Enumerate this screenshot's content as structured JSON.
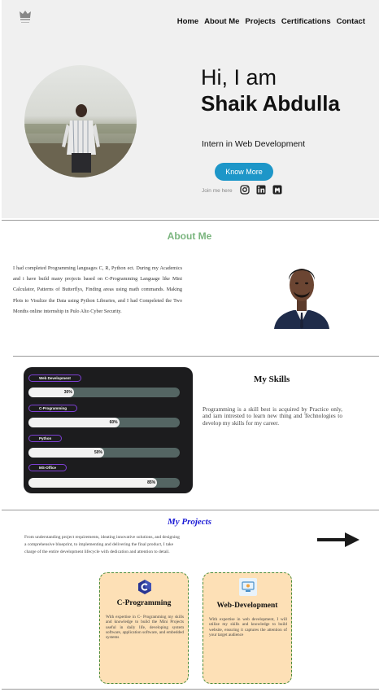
{
  "nav": {
    "items": [
      {
        "label": "Home"
      },
      {
        "label": "About Me"
      },
      {
        "label": "Projects"
      },
      {
        "label": "Certifications"
      },
      {
        "label": "Contact"
      }
    ]
  },
  "hero": {
    "greeting": "Hi, I am",
    "name": "Shaik Abdulla",
    "role": "Intern in Web Development",
    "cta_label": "Know More",
    "join_text": "Join me here",
    "social_icons": [
      "instagram-icon",
      "linkedin-icon",
      "github-icon"
    ]
  },
  "about": {
    "title": "About Me",
    "text": "I had completed Programming languages C, R, Python ect. During my Academics and i have build many projects based on C-Programming Language like Mini Calculator, Patterns of Butterflys, Finding areas using math commands. Making Plots to Visulize the Data using Python Libraries, and I had Compeleted the Two Months online internship in Pulo Alto Cyber Security."
  },
  "skills": {
    "title": "My Skills",
    "text": "Programming is a skill best is acquired by Practice only, and iam intrested to learn new thing and Technologies to develop my skills for my career.",
    "items": [
      {
        "label": "Web Development",
        "pct_label": "30%",
        "value": 0.3
      },
      {
        "label": "C-Programming",
        "pct_label": "60%",
        "value": 0.6
      },
      {
        "label": "Python",
        "pct_label": "50%",
        "value": 0.5
      },
      {
        "label": "MS-Office",
        "pct_label": "85%",
        "value": 0.85
      }
    ]
  },
  "projects": {
    "title": "My Projects",
    "intro": "From understanding project requirements, ideating innovative solutions, and designing a comprehensive blueprint, to implementing and delivering the final product, I take charge of the entire development lifecycle with dedication and attention to detail.",
    "cards": [
      {
        "title": "C-Programming",
        "icon": "c-language-icon",
        "text": "With expertise in C- Programming my skills and knowledge to build the Mini Projects useful in daily life, developing system software, application software, and embedded systems"
      },
      {
        "title": "Web-Development",
        "icon": "web-development-icon",
        "text": "With expertise in web development, I will utilize my skills and knowledge to build website, ensuring it captures the attention of your target audience"
      }
    ]
  },
  "colors": {
    "accent_button": "#1d96c8",
    "about_title": "#7ab57e",
    "projects_title": "#1a1ad6",
    "skill_border": "#7d3fd3",
    "card_bg": "#fde0b6"
  }
}
